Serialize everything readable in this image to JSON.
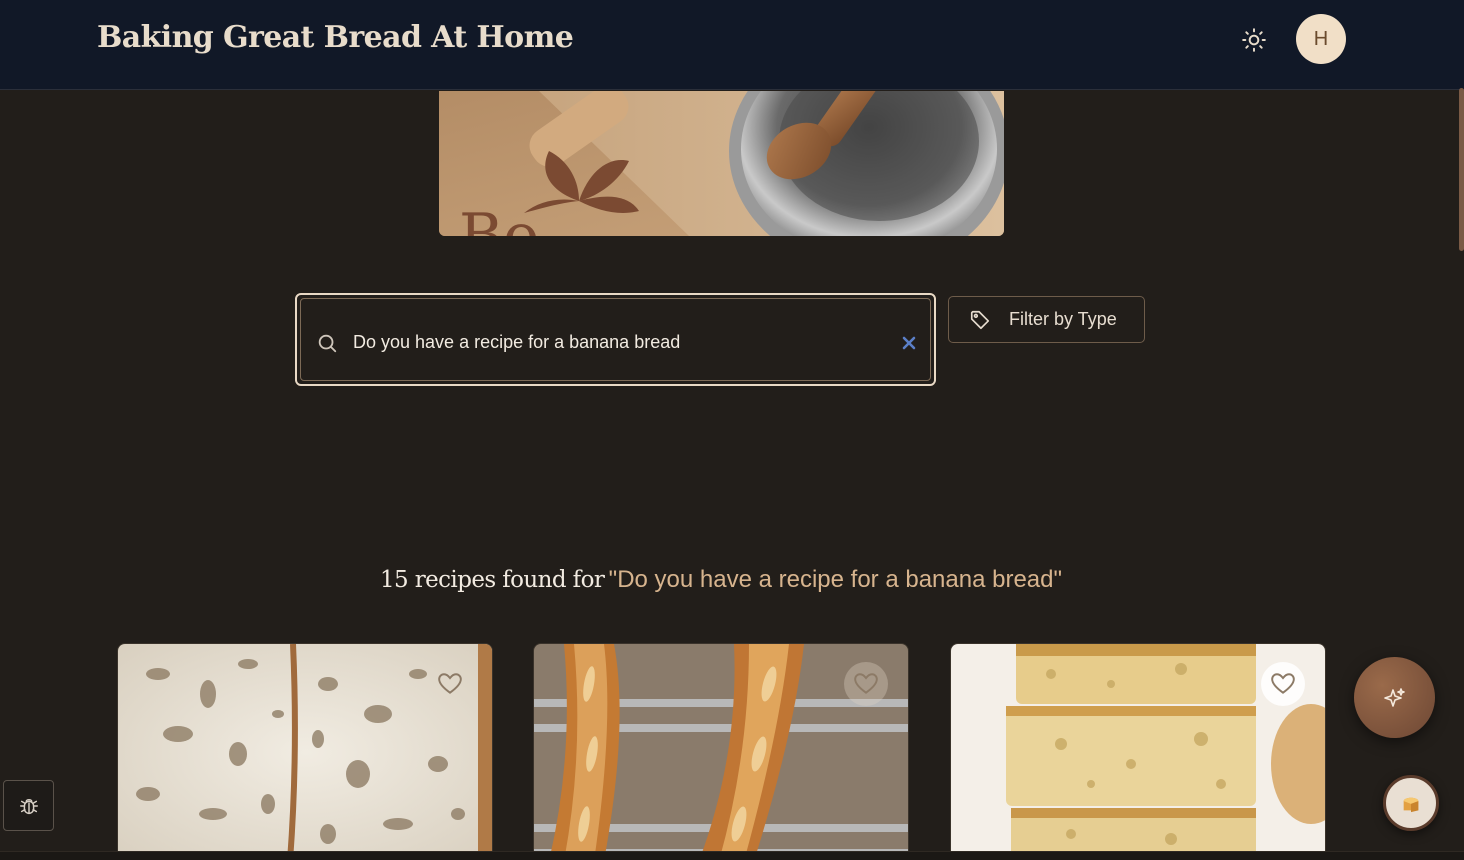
{
  "header": {
    "title": "Baking Great Bread At Home",
    "theme_toggle_icon": "sun-icon",
    "avatar_initial": "H"
  },
  "hero": {
    "image": "bakery-banner-with-wooden-spoon-and-steel-bowl"
  },
  "search": {
    "value": "Do you have a recipe for a banana bread",
    "icon": "search-icon",
    "clear_icon": "close-icon"
  },
  "filter": {
    "label": "Filter by Type",
    "icon": "tag-icon"
  },
  "results": {
    "count_text": "15 recipes found for",
    "query_text": "\"Do you have a recipe for a banana bread\""
  },
  "cards": [
    {
      "image": "sourdough-crumb-photo",
      "favorite_icon": "heart-icon"
    },
    {
      "image": "baguettes-on-rack-photo",
      "favorite_icon": "heart-icon"
    },
    {
      "image": "focaccia-stack-photo",
      "favorite_icon": "heart-icon"
    }
  ],
  "floating": {
    "ai_icon": "sparkles-icon",
    "bread_icon": "bread-icon",
    "debug_icon": "bug-icon"
  },
  "colors": {
    "background": "#221e1a",
    "header": "#111827",
    "accent": "#d7b48e",
    "avatar_bg": "#f1dfc7",
    "fab": "#7f5540"
  }
}
